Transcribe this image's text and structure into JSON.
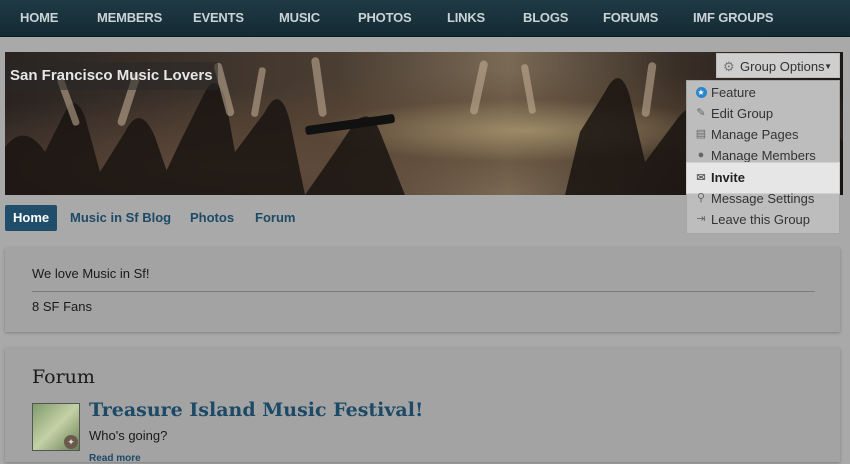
{
  "nav": {
    "items": [
      "HOME",
      "MEMBERS",
      "EVENTS",
      "MUSIC",
      "PHOTOS",
      "LINKS",
      "BLOGS",
      "FORUMS",
      "IMF GROUPS"
    ]
  },
  "group": {
    "title": "San Francisco Music Lovers",
    "options_label": "Group Options"
  },
  "dropdown": {
    "items": [
      {
        "label": "Feature",
        "icon": "star-badge-icon"
      },
      {
        "label": "Edit Group",
        "icon": "pencil-icon"
      },
      {
        "label": "Manage Pages",
        "icon": "pages-icon"
      },
      {
        "label": "Manage Members",
        "icon": "user-icon"
      },
      {
        "label": "Invite",
        "icon": "envelope-icon"
      },
      {
        "label": "Message Settings",
        "icon": "broadcast-icon"
      },
      {
        "label": "Leave this Group",
        "icon": "exit-icon"
      }
    ]
  },
  "tabs": [
    "Home",
    "Music in Sf Blog",
    "Photos",
    "Forum"
  ],
  "about": {
    "description": "We love Music in Sf!",
    "fans": "8 SF Fans"
  },
  "forum": {
    "heading": "Forum",
    "topic_title": "Treasure Island Music Festival!",
    "topic_excerpt": "Who's going?",
    "read_more": "Read more"
  },
  "colors": {
    "accent": "#1f4d6a",
    "link": "#1c4a66",
    "feature_icon": "#2a86c8"
  }
}
